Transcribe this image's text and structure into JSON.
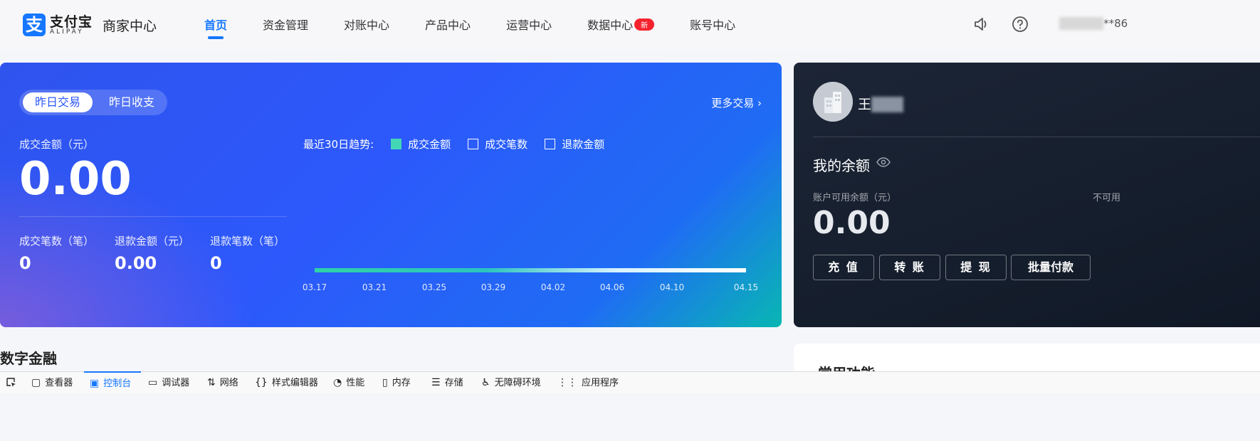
{
  "header": {
    "logo_mark": "支",
    "logo_cn": "支付宝",
    "logo_en": "ALIPAY",
    "app_name": "商家中心",
    "nav": [
      {
        "label": "首页",
        "active": true
      },
      {
        "label": "资金管理"
      },
      {
        "label": "对账中心"
      },
      {
        "label": "产品中心"
      },
      {
        "label": "运营中心"
      },
      {
        "label": "数据中心",
        "badge": "新"
      },
      {
        "label": "账号中心"
      }
    ],
    "user_suffix": "**86"
  },
  "trade": {
    "tabs": [
      "昨日交易",
      "昨日收支"
    ],
    "more": "更多交易 ›",
    "amount_label": "成交金额（元）",
    "amount_value": "0.00",
    "stats": [
      {
        "label": "成交笔数（笔）",
        "value": "0"
      },
      {
        "label": "退款金额（元）",
        "value": "0.00"
      },
      {
        "label": "退款笔数（笔）",
        "value": "0"
      }
    ],
    "trend_label": "最近30日趋势:",
    "legend": [
      "成交金额",
      "成交笔数",
      "退款金额"
    ],
    "ticks": [
      "03.17",
      "03.21",
      "03.25",
      "03.29",
      "04.02",
      "04.06",
      "04.10",
      "04.15"
    ]
  },
  "account": {
    "name": "王",
    "balance_title": "我的余额",
    "balance_label": "账户可用余额（元）",
    "unavailable_label": "不可用",
    "balance_value": "0.00",
    "buttons": [
      "充 值",
      "转 账",
      "提 现",
      "批量付款"
    ]
  },
  "sections": {
    "finance_title": "数字金融",
    "common_title": "常用功能"
  },
  "devtools": {
    "tabs": [
      "查看器",
      "控制台",
      "调试器",
      "网络",
      "样式编辑器",
      "性能",
      "内存",
      "存储",
      "无障碍环境",
      "应用程序"
    ],
    "active": "控制台"
  },
  "colors": {
    "primary": "#1677ff",
    "badge": "#f5222d",
    "trend_series": "#44d7b6"
  }
}
